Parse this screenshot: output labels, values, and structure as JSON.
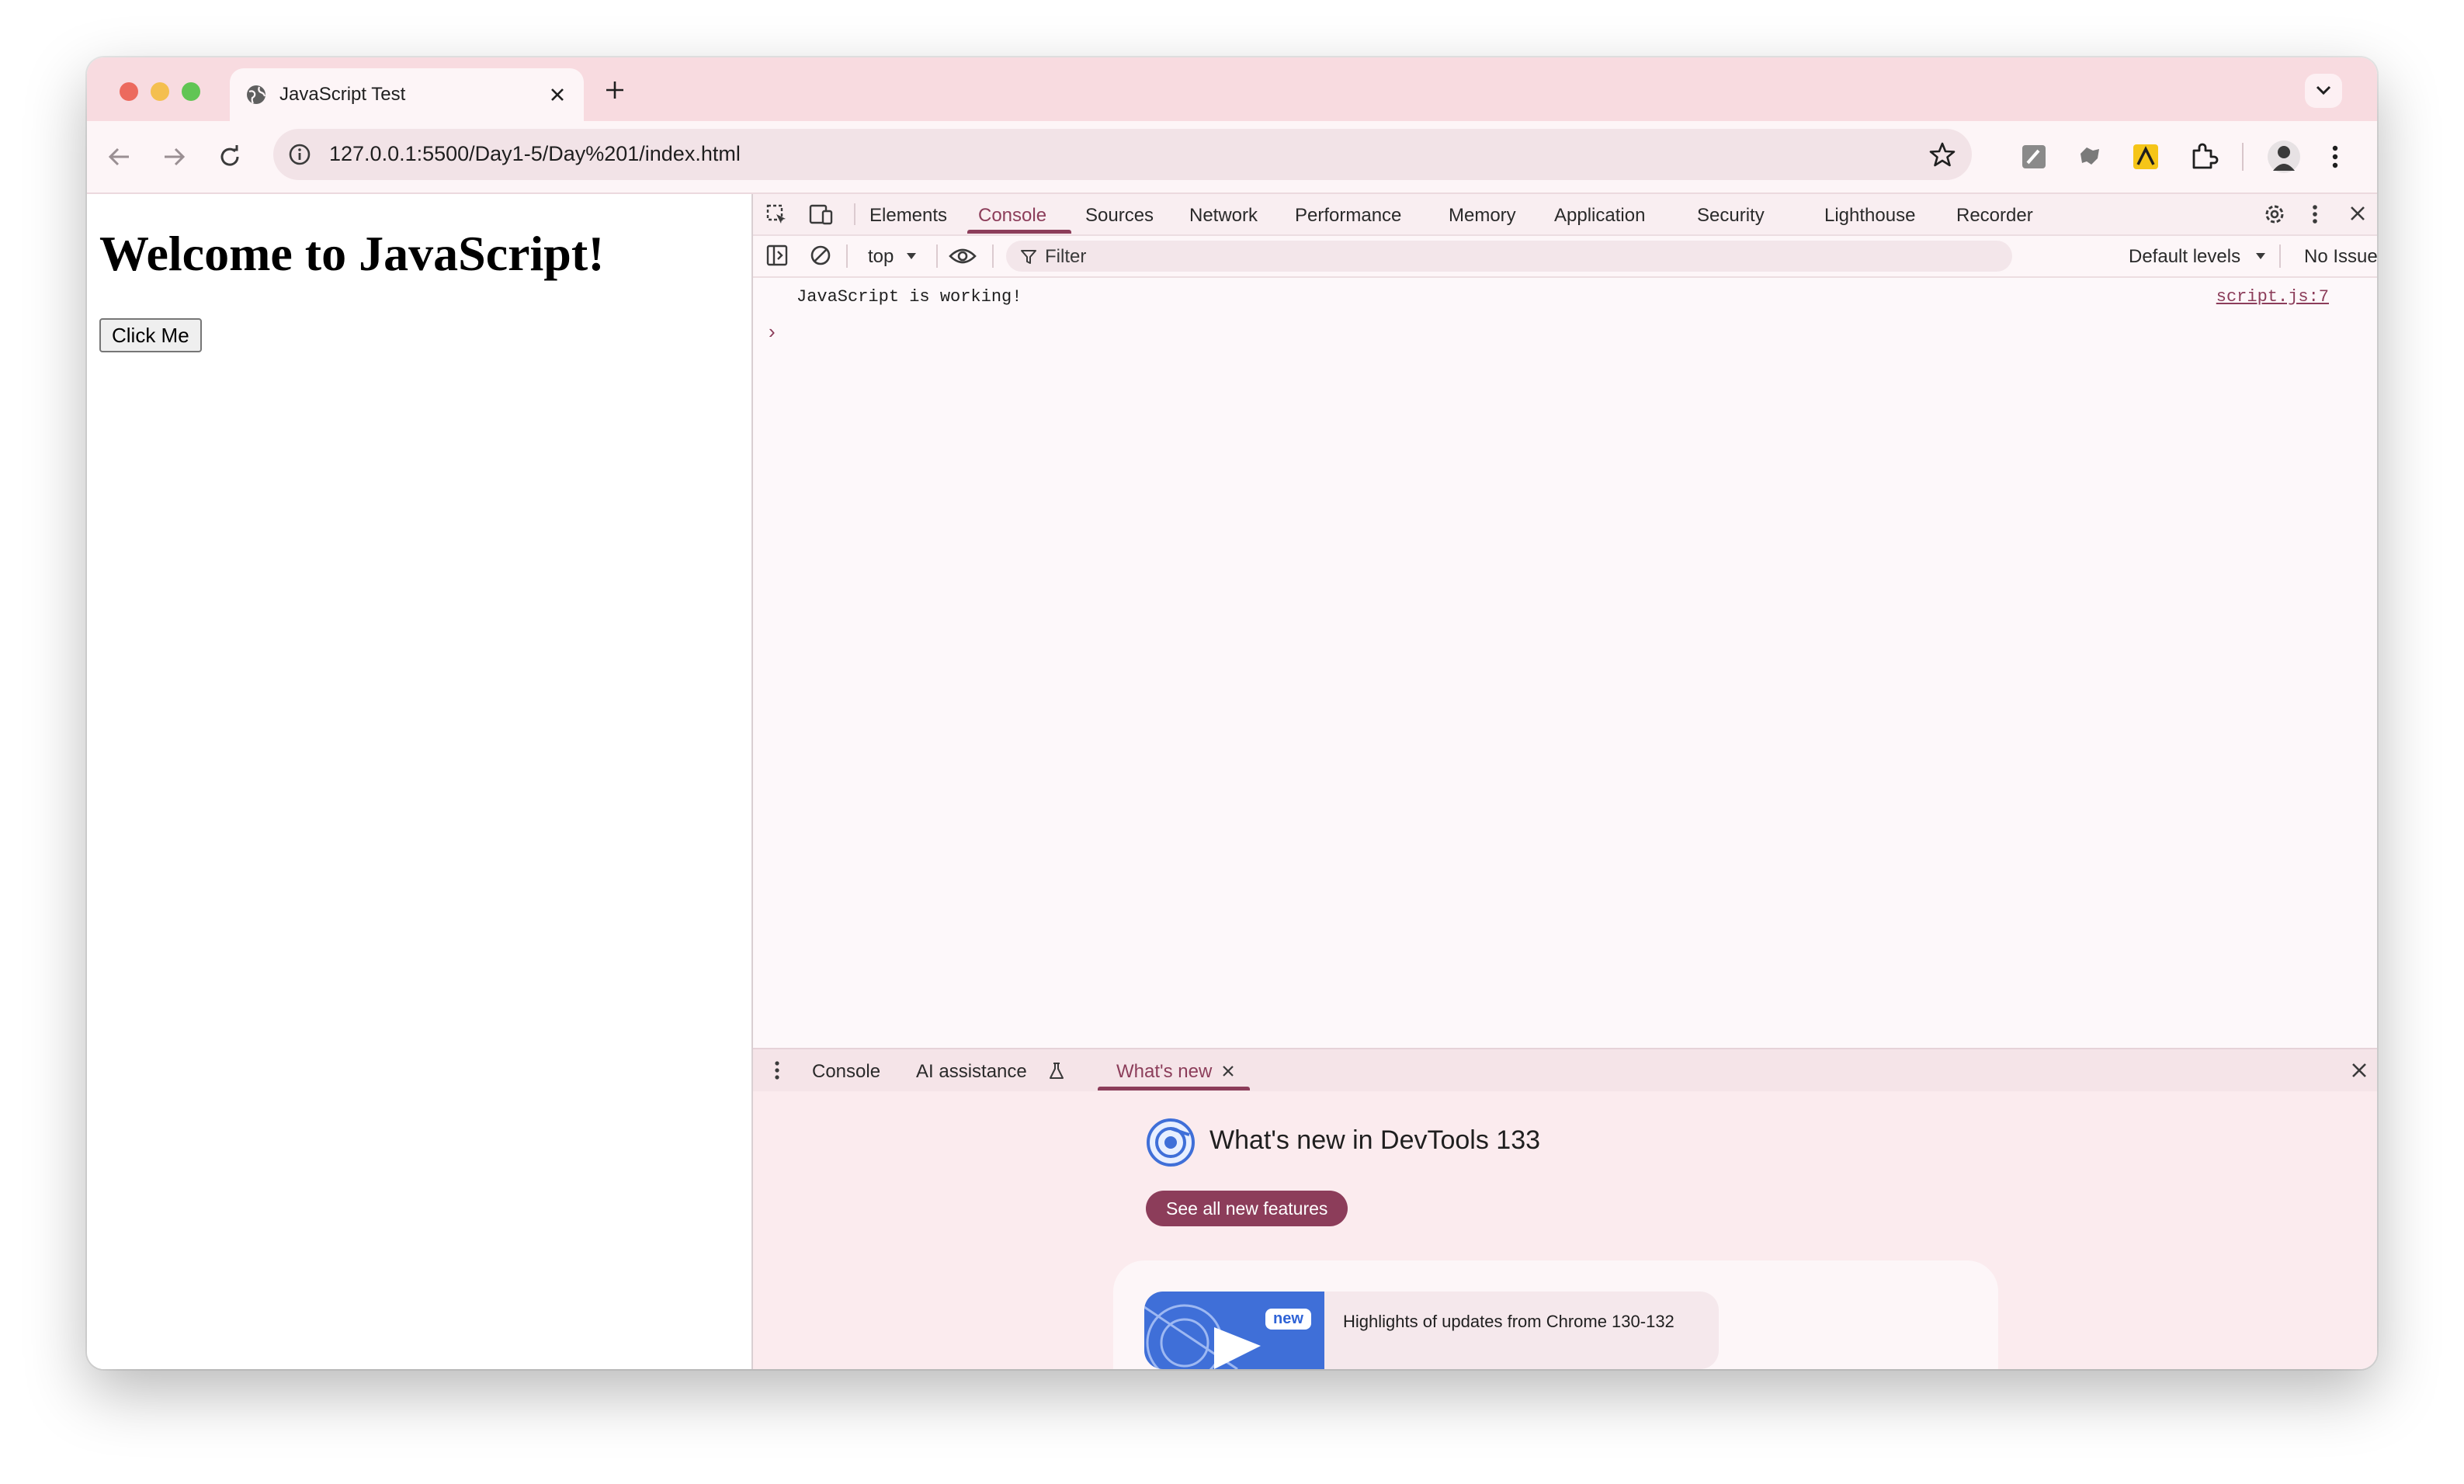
{
  "browser": {
    "tab_title": "JavaScript Test",
    "url": "127.0.0.1:5500/Day1-5/Day%201/index.html"
  },
  "page": {
    "heading": "Welcome to JavaScript!",
    "button_label": "Click Me"
  },
  "devtools": {
    "tabs": [
      "Elements",
      "Console",
      "Sources",
      "Network",
      "Performance",
      "Memory",
      "Application",
      "Security",
      "Lighthouse",
      "Recorder"
    ],
    "active_tab": "Console",
    "context": "top",
    "filter_placeholder": "Filter",
    "levels": "Default levels",
    "issues": "No Issues",
    "console_log": {
      "message": "JavaScript is working!",
      "source": "script.js:7"
    },
    "prompt": "›",
    "drawer": {
      "tabs": {
        "console": "Console",
        "ai": "AI assistance",
        "whats_new": "What's new"
      },
      "whats_new": {
        "title": "What's new in DevTools 133",
        "button": "See all new features",
        "badge": "new",
        "highlight": "Highlights of updates from Chrome 130-132"
      }
    }
  },
  "colors": {
    "accent": "#8c3d5a",
    "titlebar": "#f8dbe0",
    "toolbar": "#fdf5f7"
  }
}
